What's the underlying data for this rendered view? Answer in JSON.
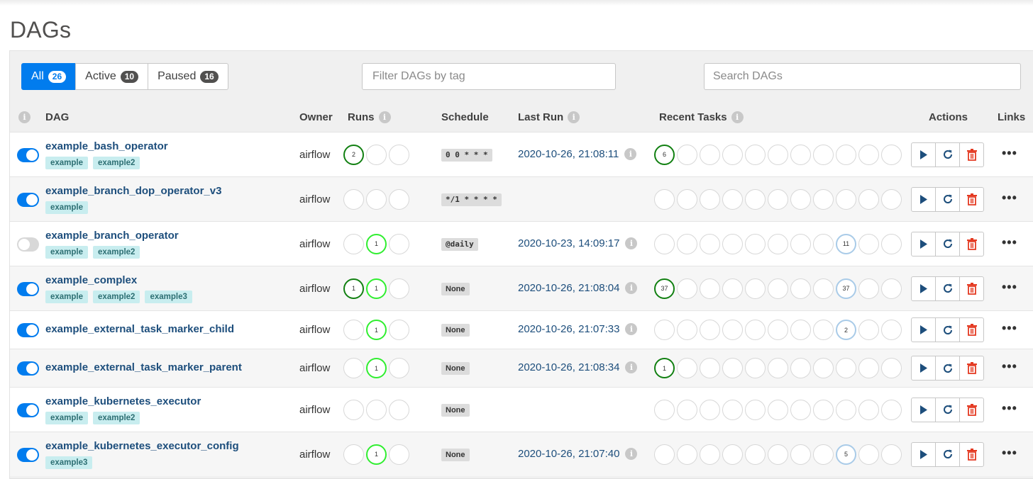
{
  "page": {
    "title": "DAGs"
  },
  "filters": [
    {
      "label": "All",
      "count": "26",
      "active": true
    },
    {
      "label": "Active",
      "count": "10",
      "active": false
    },
    {
      "label": "Paused",
      "count": "16",
      "active": false
    }
  ],
  "tag_filter": {
    "placeholder": "Filter DAGs by tag"
  },
  "search": {
    "placeholder": "Search DAGs"
  },
  "headers": {
    "info": "i",
    "dag": "DAG",
    "owner": "Owner",
    "runs": "Runs",
    "schedule": "Schedule",
    "last_run": "Last Run",
    "recent_tasks": "Recent Tasks",
    "actions": "Actions",
    "links": "Links"
  },
  "links_label": "•••",
  "dags": [
    {
      "name": "example_bash_operator",
      "enabled": true,
      "tags": [
        "example",
        "example2"
      ],
      "owner": "airflow",
      "runs": [
        {
          "n": "2",
          "s": "success"
        },
        {
          "n": "",
          "s": ""
        },
        {
          "n": "",
          "s": ""
        }
      ],
      "schedule": "0 0 * * *",
      "last_run": "2020-10-26, 21:08:11",
      "tasks": [
        {
          "n": "6",
          "s": "success"
        },
        {},
        {},
        {},
        {},
        {},
        {},
        {},
        {},
        {},
        {}
      ]
    },
    {
      "name": "example_branch_dop_operator_v3",
      "enabled": true,
      "tags": [
        "example"
      ],
      "owner": "airflow",
      "runs": [
        {
          "n": "",
          "s": ""
        },
        {
          "n": "",
          "s": ""
        },
        {
          "n": "",
          "s": ""
        }
      ],
      "schedule": "*/1 * * * *",
      "last_run": "",
      "tasks": [
        {},
        {},
        {},
        {},
        {},
        {},
        {},
        {},
        {},
        {},
        {}
      ]
    },
    {
      "name": "example_branch_operator",
      "enabled": false,
      "tags": [
        "example",
        "example2"
      ],
      "owner": "airflow",
      "runs": [
        {
          "n": "",
          "s": ""
        },
        {
          "n": "1",
          "s": "running"
        },
        {
          "n": "",
          "s": ""
        }
      ],
      "schedule": "@daily",
      "last_run": "2020-10-23, 14:09:17",
      "tasks": [
        {},
        {},
        {},
        {},
        {},
        {},
        {},
        {},
        {
          "n": "11",
          "s": "skipped"
        },
        {},
        {}
      ]
    },
    {
      "name": "example_complex",
      "enabled": true,
      "tags": [
        "example",
        "example2",
        "example3"
      ],
      "owner": "airflow",
      "runs": [
        {
          "n": "1",
          "s": "success"
        },
        {
          "n": "1",
          "s": "running"
        },
        {
          "n": "",
          "s": ""
        }
      ],
      "schedule": "None",
      "last_run": "2020-10-26, 21:08:04",
      "tasks": [
        {
          "n": "37",
          "s": "success"
        },
        {},
        {},
        {},
        {},
        {},
        {},
        {},
        {
          "n": "37",
          "s": "skipped"
        },
        {},
        {}
      ]
    },
    {
      "name": "example_external_task_marker_child",
      "enabled": true,
      "tags": [],
      "owner": "airflow",
      "runs": [
        {
          "n": "",
          "s": ""
        },
        {
          "n": "1",
          "s": "running"
        },
        {
          "n": "",
          "s": ""
        }
      ],
      "schedule": "None",
      "last_run": "2020-10-26, 21:07:33",
      "tasks": [
        {},
        {},
        {},
        {},
        {},
        {},
        {},
        {},
        {
          "n": "2",
          "s": "skipped"
        },
        {},
        {}
      ]
    },
    {
      "name": "example_external_task_marker_parent",
      "enabled": true,
      "tags": [],
      "owner": "airflow",
      "runs": [
        {
          "n": "",
          "s": ""
        },
        {
          "n": "1",
          "s": "running"
        },
        {
          "n": "",
          "s": ""
        }
      ],
      "schedule": "None",
      "last_run": "2020-10-26, 21:08:34",
      "tasks": [
        {
          "n": "1",
          "s": "success"
        },
        {},
        {},
        {},
        {},
        {},
        {},
        {},
        {},
        {},
        {}
      ]
    },
    {
      "name": "example_kubernetes_executor",
      "enabled": true,
      "tags": [
        "example",
        "example2"
      ],
      "owner": "airflow",
      "runs": [
        {
          "n": "",
          "s": ""
        },
        {
          "n": "",
          "s": ""
        },
        {
          "n": "",
          "s": ""
        }
      ],
      "schedule": "None",
      "last_run": "",
      "tasks": [
        {},
        {},
        {},
        {},
        {},
        {},
        {},
        {},
        {},
        {},
        {}
      ]
    },
    {
      "name": "example_kubernetes_executor_config",
      "enabled": true,
      "tags": [
        "example3"
      ],
      "owner": "airflow",
      "runs": [
        {
          "n": "",
          "s": ""
        },
        {
          "n": "1",
          "s": "running"
        },
        {
          "n": "",
          "s": ""
        }
      ],
      "schedule": "None",
      "last_run": "2020-10-26, 21:07:40",
      "tasks": [
        {},
        {},
        {},
        {},
        {},
        {},
        {},
        {},
        {
          "n": "5",
          "s": "skipped"
        },
        {},
        {}
      ]
    }
  ],
  "colors": {
    "accent": "#017cee",
    "success": "#128012",
    "running": "#30ee30",
    "skipped": "#a9cbe8",
    "delete": "#e43921"
  },
  "icons": {
    "play": "play-icon",
    "refresh": "refresh-icon",
    "delete": "trash-icon",
    "links": "more-icon",
    "info": "info-icon"
  }
}
